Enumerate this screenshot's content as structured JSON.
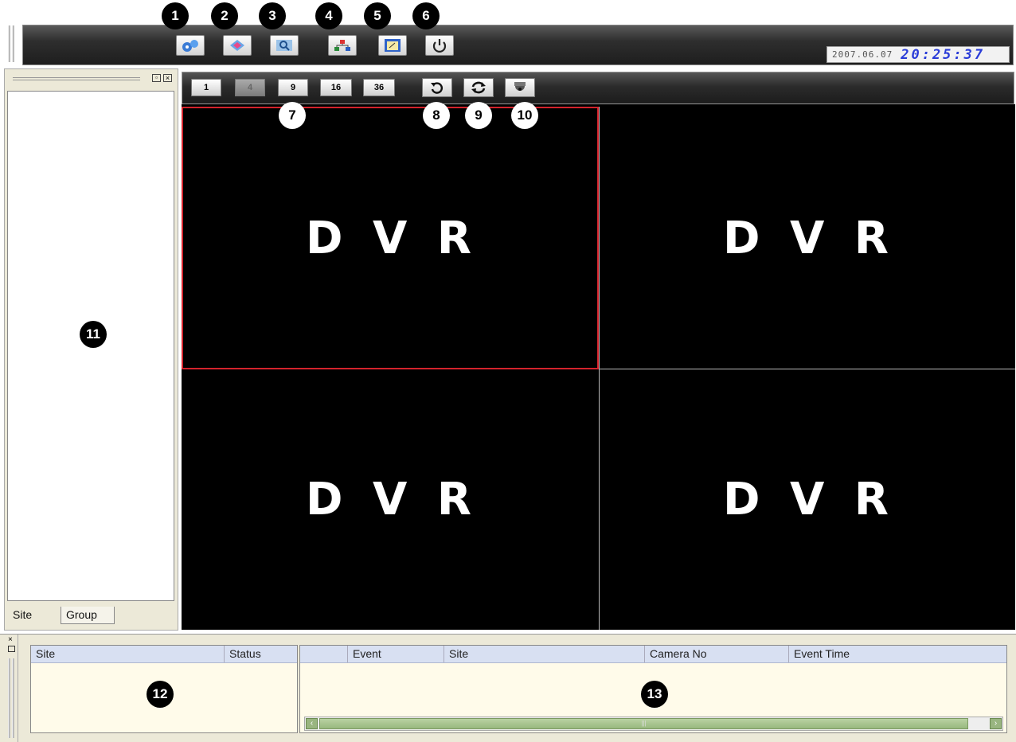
{
  "top_toolbar": {
    "buttons": [
      {
        "icon": "gear-cluster-icon"
      },
      {
        "icon": "network-setup-icon"
      },
      {
        "icon": "search-icon"
      },
      {
        "icon": "site-tree-icon"
      },
      {
        "icon": "notepad-icon"
      },
      {
        "icon": "power-icon"
      }
    ],
    "date": "2007.06.07",
    "time": "20:25:37"
  },
  "callouts": {
    "c1": "1",
    "c2": "2",
    "c3": "3",
    "c4": "4",
    "c5": "5",
    "c6": "6",
    "c7": "7",
    "c8": "8",
    "c9": "9",
    "c10": "10",
    "c11": "11",
    "c12": "12",
    "c13": "13"
  },
  "video_toolbar": {
    "layouts": [
      {
        "label": "1",
        "enabled": true
      },
      {
        "label": "4",
        "enabled": false
      },
      {
        "label": "9",
        "enabled": true
      },
      {
        "label": "16",
        "enabled": true
      },
      {
        "label": "36",
        "enabled": true
      }
    ],
    "action_icons": [
      "undo-icon",
      "refresh-icon",
      "camera-icon"
    ]
  },
  "video_cells": [
    {
      "label": "D V R",
      "selected": true
    },
    {
      "label": "D V R",
      "selected": false
    },
    {
      "label": "D V R",
      "selected": false
    },
    {
      "label": "D V R",
      "selected": false
    }
  ],
  "left_panel": {
    "tabs": [
      "Site",
      "Group"
    ],
    "active_tab": "Site"
  },
  "site_table": {
    "columns": [
      "Site",
      "Status"
    ]
  },
  "event_table": {
    "columns": [
      "",
      "Event",
      "Site",
      "Camera No",
      "Event Time"
    ]
  },
  "colors": {
    "selected_cell_border": "#d3232c",
    "time_digits": "#2a3cd8",
    "table_header": "#d8e0f2",
    "scrollbar": "#99b580"
  }
}
